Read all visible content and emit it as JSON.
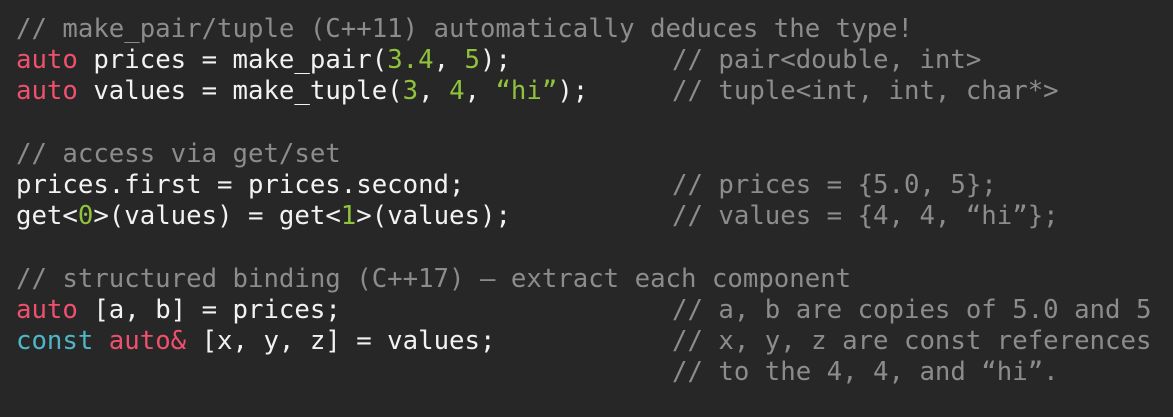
{
  "colors": {
    "background": "#272727",
    "text": "#f2f2f2",
    "comment": "#8c8c8c",
    "keyword": "#f0506e",
    "qualifier": "#4fb6c7",
    "literal": "#90c33c"
  },
  "lines": [
    {
      "code": [
        {
          "t": "// make_pair/tuple (C++11) automatically deduces the type!",
          "k": "c"
        }
      ],
      "comment": ""
    },
    {
      "code": [
        {
          "t": "auto",
          "k": "k"
        },
        {
          "t": " prices = make_pair(",
          "k": "t"
        },
        {
          "t": "3.4",
          "k": "n"
        },
        {
          "t": ", ",
          "k": "t"
        },
        {
          "t": "5",
          "k": "n"
        },
        {
          "t": ");",
          "k": "t"
        }
      ],
      "comment": "// pair<double, int>"
    },
    {
      "code": [
        {
          "t": "auto",
          "k": "k"
        },
        {
          "t": " values = make_tuple(",
          "k": "t"
        },
        {
          "t": "3",
          "k": "n"
        },
        {
          "t": ", ",
          "k": "t"
        },
        {
          "t": "4",
          "k": "n"
        },
        {
          "t": ", ",
          "k": "t"
        },
        {
          "t": "“hi”",
          "k": "n"
        },
        {
          "t": ");",
          "k": "t"
        }
      ],
      "comment": "// tuple<int, int, char*>"
    },
    {
      "code": [],
      "comment": ""
    },
    {
      "code": [
        {
          "t": "// access via get/set",
          "k": "c"
        }
      ],
      "comment": ""
    },
    {
      "code": [
        {
          "t": "prices.first = prices.second;",
          "k": "t"
        }
      ],
      "comment": "// prices = {5.0, 5};"
    },
    {
      "code": [
        {
          "t": "get<",
          "k": "t"
        },
        {
          "t": "0",
          "k": "n"
        },
        {
          "t": ">(values) = get<",
          "k": "t"
        },
        {
          "t": "1",
          "k": "n"
        },
        {
          "t": ">(values);",
          "k": "t"
        }
      ],
      "comment": "// values = {4, 4, “hi”};"
    },
    {
      "code": [],
      "comment": ""
    },
    {
      "code": [
        {
          "t": "// structured binding (C++17) – extract each component",
          "k": "c"
        }
      ],
      "comment": ""
    },
    {
      "code": [
        {
          "t": "auto",
          "k": "k"
        },
        {
          "t": " [a, b] = prices;",
          "k": "t"
        }
      ],
      "comment": "// a, b are copies of 5.0 and 5"
    },
    {
      "code": [
        {
          "t": "const",
          "k": "q"
        },
        {
          "t": " ",
          "k": "t"
        },
        {
          "t": "auto&",
          "k": "k"
        },
        {
          "t": " [x, y, z] = values;",
          "k": "t"
        }
      ],
      "comment": "// x, y, z are const references"
    },
    {
      "code": [],
      "comment": "// to the 4, 4, and “hi”."
    }
  ]
}
